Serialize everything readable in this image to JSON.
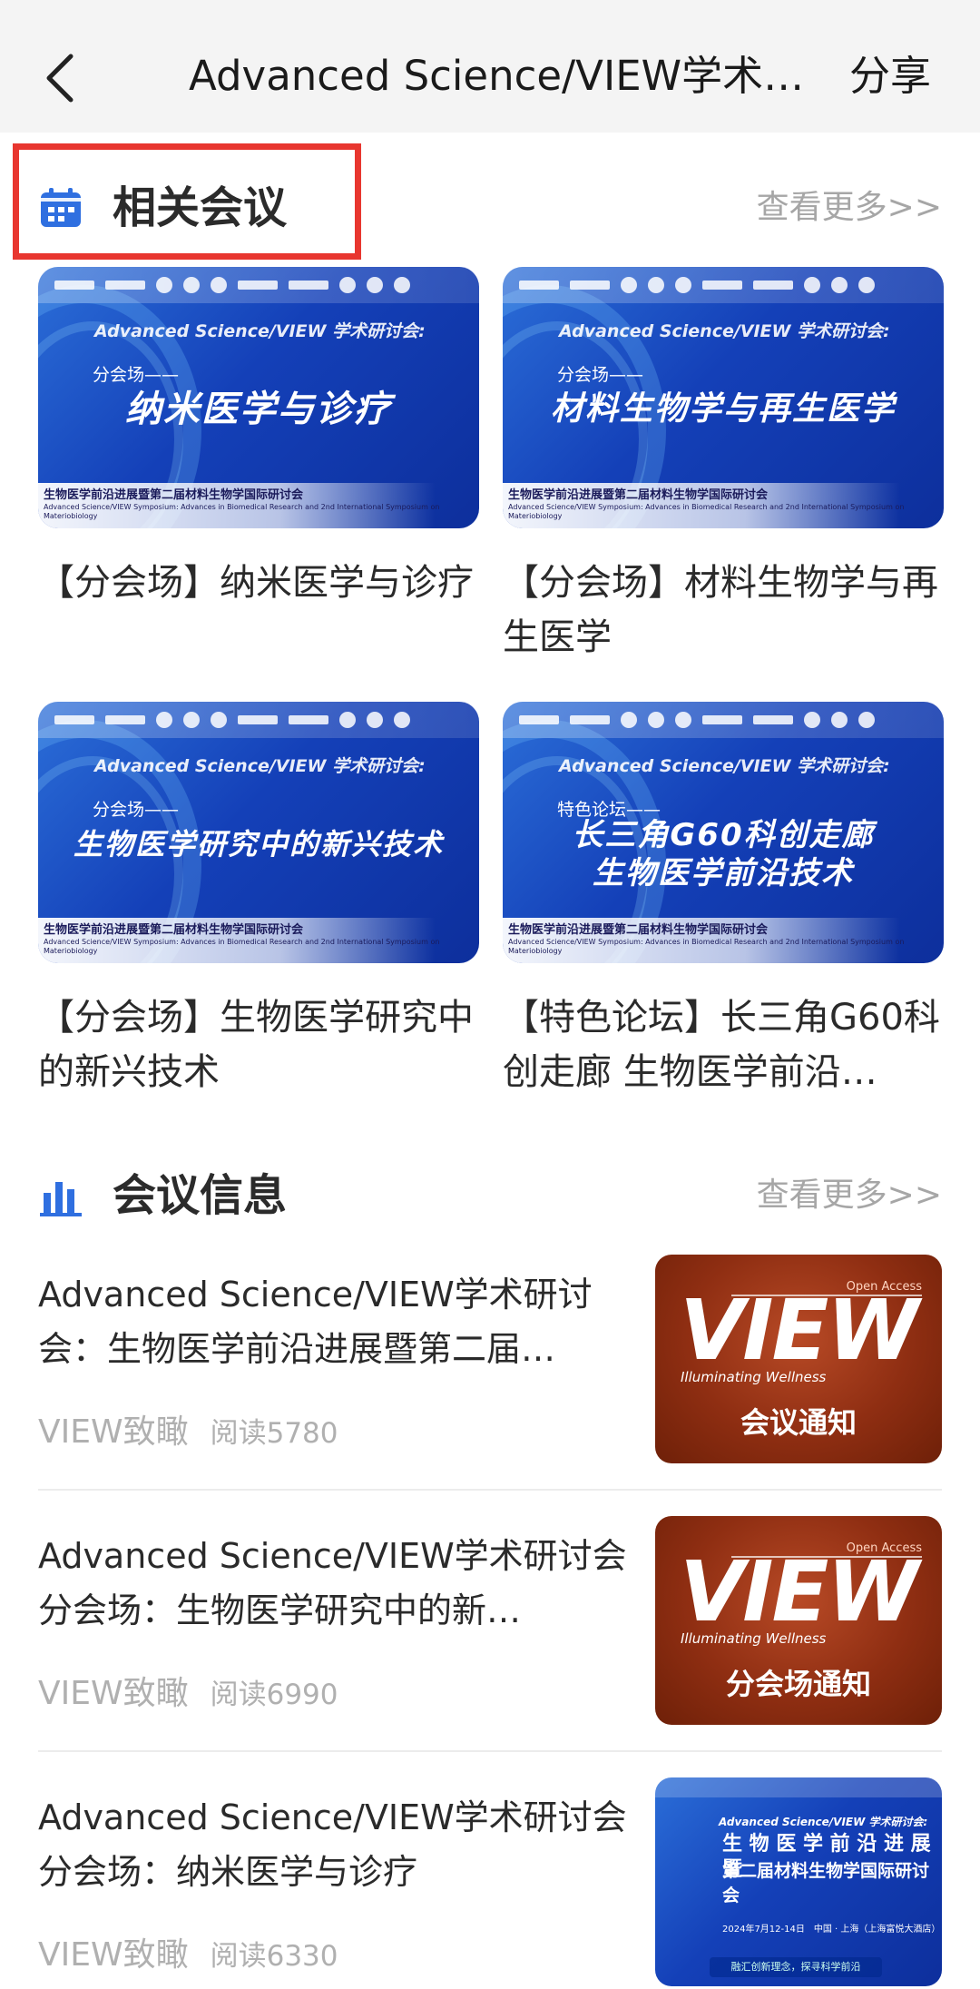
{
  "nav": {
    "title": "Advanced Science/VIEW学术…",
    "share_label": "分享"
  },
  "related": {
    "title": "相关会议",
    "more_label": "查看更多>>",
    "cards": [
      {
        "banner_sub": "Advanced Science/VIEW 学术研讨会:",
        "banner_tag": "分会场——",
        "banner_main": "纳米医学与诊疗",
        "banner_foot": "生物医学前沿进展暨第二届材料生物学国际研讨会",
        "banner_foot_en": "Advanced Science/VIEW Symposium: Advances in Biomedical Research and 2nd International Symposium on Materiobiology",
        "title": "【分会场】纳米医学与诊疗"
      },
      {
        "banner_sub": "Advanced Science/VIEW 学术研讨会:",
        "banner_tag": "分会场——",
        "banner_main": "材料生物学与再生医学",
        "banner_foot": "生物医学前沿进展暨第二届材料生物学国际研讨会",
        "banner_foot_en": "Advanced Science/VIEW Symposium: Advances in Biomedical Research and 2nd International Symposium on Materiobiology",
        "title": "【分会场】材料生物学与再生医学"
      },
      {
        "banner_sub": "Advanced Science/VIEW 学术研讨会:",
        "banner_tag": "分会场——",
        "banner_main": "生物医学研究中的新兴技术",
        "banner_foot": "生物医学前沿进展暨第二届材料生物学国际研讨会",
        "banner_foot_en": "Advanced Science/VIEW Symposium: Advances in Biomedical Research and 2nd International Symposium on Materiobiology",
        "title": "【分会场】生物医学研究中的新兴技术"
      },
      {
        "banner_sub": "Advanced Science/VIEW 学术研讨会:",
        "banner_tag": "特色论坛——",
        "banner_main_1": "长三角G60科创走廊",
        "banner_main_2": "生物医学前沿技术",
        "banner_foot": "生物医学前沿进展暨第二届材料生物学国际研讨会",
        "banner_foot_en": "Advanced Science/VIEW Symposium: Advances in Biomedical Research and 2nd International Symposium on Materiobiology",
        "title": "【特色论坛】长三角G60科创走廊 生物医学前沿…"
      }
    ]
  },
  "info": {
    "title": "会议信息",
    "more_label": "查看更多>>",
    "items": [
      {
        "title": "Advanced Science/VIEW学术研讨会：生物医学前沿进展暨第二届…",
        "source": "VIEW致瞰",
        "reads": "阅读5780",
        "thumb_oa": "Open Access",
        "thumb_big": "VIEW",
        "thumb_tag": "Illuminating Wellness",
        "thumb_caption": "会议通知"
      },
      {
        "title": "Advanced Science/VIEW学术研讨会分会场：生物医学研究中的新…",
        "source": "VIEW致瞰",
        "reads": "阅读6990",
        "thumb_oa": "Open Access",
        "thumb_big": "VIEW",
        "thumb_tag": "Illuminating Wellness",
        "thumb_caption": "分会场通知"
      },
      {
        "title": "Advanced Science/VIEW学术研讨会分会场：纳米医学与诊疗",
        "source": "VIEW致瞰",
        "reads": "阅读6330",
        "thumb_sub": "Advanced Science/VIEW 学术研讨会:",
        "thumb_main": "生 物 医 学 前 沿 进 展 暨",
        "thumb_main2": "第二届材料生物学国际研讨会",
        "thumb_date": "2024年7月12-14日　中国 · 上海（上海富悦大酒店）",
        "thumb_bottom": "融汇创新理念，探寻科学前沿"
      }
    ]
  },
  "colors": {
    "highlight_box": "#e8362f",
    "icon_blue": "#2f6fe0",
    "muted": "#a6a6a6",
    "banner_blue": "#1440b8",
    "view_red": "#8f2e12"
  }
}
